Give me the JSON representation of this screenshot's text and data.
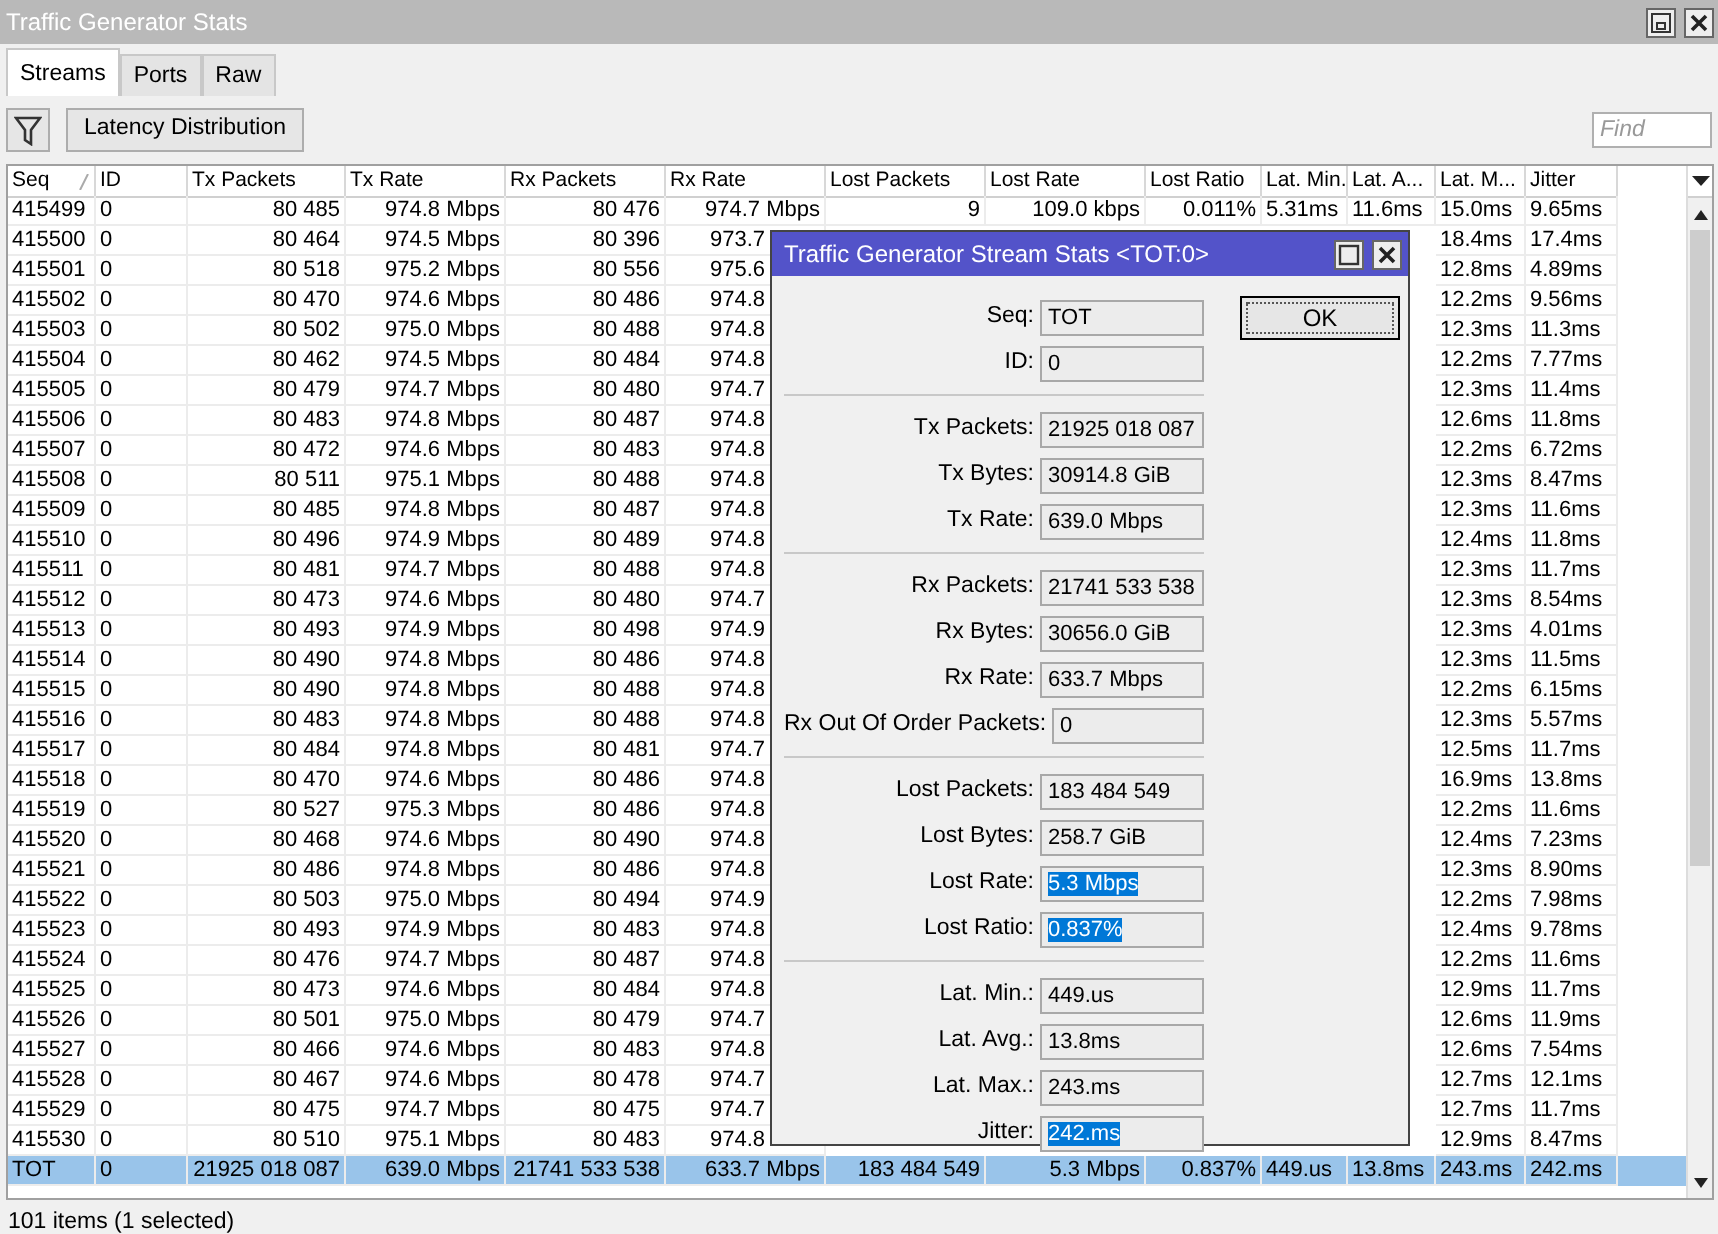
{
  "window": {
    "title": "Traffic Generator Stats"
  },
  "tabs": [
    {
      "label": "Streams",
      "selected": true
    },
    {
      "label": "Ports",
      "selected": false
    },
    {
      "label": "Raw",
      "selected": false
    }
  ],
  "toolbar": {
    "buttons": [
      "Latency Distribution"
    ],
    "find": {
      "placeholder": "Find"
    }
  },
  "table": {
    "columns": [
      {
        "label": "Seq",
        "sorted": true
      },
      {
        "label": "ID",
        "sorted": false
      },
      {
        "label": "Tx Packets",
        "sorted": false
      },
      {
        "label": "Tx Rate",
        "sorted": false
      },
      {
        "label": "Rx Packets",
        "sorted": false
      },
      {
        "label": "Rx Rate",
        "sorted": false
      },
      {
        "label": "Lost Packets",
        "sorted": false
      },
      {
        "label": "Lost Rate",
        "sorted": false
      },
      {
        "label": "Lost Ratio",
        "sorted": false
      },
      {
        "label": "Lat. Min.",
        "sorted": false
      },
      {
        "label": "Lat. A...",
        "sorted": false
      },
      {
        "label": "Lat. M...",
        "sorted": false
      },
      {
        "label": "Jitter",
        "sorted": false
      }
    ],
    "rows": [
      {
        "selected": false,
        "cells": [
          "415499",
          "0",
          "80 485",
          "974.8 Mbps",
          "80 476",
          "974.7 Mbps",
          "9",
          "109.0 kbps",
          "0.011%",
          "5.31ms",
          "11.6ms",
          "15.0ms",
          "9.65ms"
        ]
      },
      {
        "selected": false,
        "cells": [
          "415500",
          "0",
          "80 464",
          "974.5 Mbps",
          "80 396",
          "973.7",
          null,
          null,
          null,
          null,
          null,
          "18.4ms",
          "17.4ms"
        ]
      },
      {
        "selected": false,
        "cells": [
          "415501",
          "0",
          "80 518",
          "975.2 Mbps",
          "80 556",
          "975.6",
          null,
          null,
          null,
          null,
          null,
          "12.8ms",
          "4.89ms"
        ]
      },
      {
        "selected": false,
        "cells": [
          "415502",
          "0",
          "80 470",
          "974.6 Mbps",
          "80 486",
          "974.8",
          null,
          null,
          null,
          null,
          null,
          "12.2ms",
          "9.56ms"
        ]
      },
      {
        "selected": false,
        "cells": [
          "415503",
          "0",
          "80 502",
          "975.0 Mbps",
          "80 488",
          "974.8",
          null,
          null,
          null,
          null,
          null,
          "12.3ms",
          "11.3ms"
        ]
      },
      {
        "selected": false,
        "cells": [
          "415504",
          "0",
          "80 462",
          "974.5 Mbps",
          "80 484",
          "974.8",
          null,
          null,
          null,
          null,
          null,
          "12.2ms",
          "7.77ms"
        ]
      },
      {
        "selected": false,
        "cells": [
          "415505",
          "0",
          "80 479",
          "974.7 Mbps",
          "80 480",
          "974.7",
          null,
          null,
          null,
          null,
          null,
          "12.3ms",
          "11.4ms"
        ]
      },
      {
        "selected": false,
        "cells": [
          "415506",
          "0",
          "80 483",
          "974.8 Mbps",
          "80 487",
          "974.8",
          null,
          null,
          null,
          null,
          null,
          "12.6ms",
          "11.8ms"
        ]
      },
      {
        "selected": false,
        "cells": [
          "415507",
          "0",
          "80 472",
          "974.6 Mbps",
          "80 483",
          "974.8",
          null,
          null,
          null,
          null,
          null,
          "12.2ms",
          "6.72ms"
        ]
      },
      {
        "selected": false,
        "cells": [
          "415508",
          "0",
          "80 511",
          "975.1 Mbps",
          "80 488",
          "974.8",
          null,
          null,
          null,
          null,
          null,
          "12.3ms",
          "8.47ms"
        ]
      },
      {
        "selected": false,
        "cells": [
          "415509",
          "0",
          "80 485",
          "974.8 Mbps",
          "80 487",
          "974.8",
          null,
          null,
          null,
          null,
          null,
          "12.3ms",
          "11.6ms"
        ]
      },
      {
        "selected": false,
        "cells": [
          "415510",
          "0",
          "80 496",
          "974.9 Mbps",
          "80 489",
          "974.8",
          null,
          null,
          null,
          null,
          null,
          "12.4ms",
          "11.8ms"
        ]
      },
      {
        "selected": false,
        "cells": [
          "415511",
          "0",
          "80 481",
          "974.7 Mbps",
          "80 488",
          "974.8",
          null,
          null,
          null,
          null,
          null,
          "12.3ms",
          "11.7ms"
        ]
      },
      {
        "selected": false,
        "cells": [
          "415512",
          "0",
          "80 473",
          "974.6 Mbps",
          "80 480",
          "974.7",
          null,
          null,
          null,
          null,
          null,
          "12.3ms",
          "8.54ms"
        ]
      },
      {
        "selected": false,
        "cells": [
          "415513",
          "0",
          "80 493",
          "974.9 Mbps",
          "80 498",
          "974.9",
          null,
          null,
          null,
          null,
          null,
          "12.3ms",
          "4.01ms"
        ]
      },
      {
        "selected": false,
        "cells": [
          "415514",
          "0",
          "80 490",
          "974.8 Mbps",
          "80 486",
          "974.8",
          null,
          null,
          null,
          null,
          null,
          "12.3ms",
          "11.5ms"
        ]
      },
      {
        "selected": false,
        "cells": [
          "415515",
          "0",
          "80 490",
          "974.8 Mbps",
          "80 488",
          "974.8",
          null,
          null,
          null,
          null,
          null,
          "12.2ms",
          "6.15ms"
        ]
      },
      {
        "selected": false,
        "cells": [
          "415516",
          "0",
          "80 483",
          "974.8 Mbps",
          "80 488",
          "974.8",
          null,
          null,
          null,
          null,
          null,
          "12.3ms",
          "5.57ms"
        ]
      },
      {
        "selected": false,
        "cells": [
          "415517",
          "0",
          "80 484",
          "974.8 Mbps",
          "80 481",
          "974.7",
          null,
          null,
          null,
          null,
          null,
          "12.5ms",
          "11.7ms"
        ]
      },
      {
        "selected": false,
        "cells": [
          "415518",
          "0",
          "80 470",
          "974.6 Mbps",
          "80 486",
          "974.8",
          null,
          null,
          null,
          null,
          null,
          "16.9ms",
          "13.8ms"
        ]
      },
      {
        "selected": false,
        "cells": [
          "415519",
          "0",
          "80 527",
          "975.3 Mbps",
          "80 486",
          "974.8",
          null,
          null,
          null,
          null,
          null,
          "12.2ms",
          "11.6ms"
        ]
      },
      {
        "selected": false,
        "cells": [
          "415520",
          "0",
          "80 468",
          "974.6 Mbps",
          "80 490",
          "974.8",
          null,
          null,
          null,
          null,
          null,
          "12.4ms",
          "7.23ms"
        ]
      },
      {
        "selected": false,
        "cells": [
          "415521",
          "0",
          "80 486",
          "974.8 Mbps",
          "80 486",
          "974.8",
          null,
          null,
          null,
          null,
          null,
          "12.3ms",
          "8.90ms"
        ]
      },
      {
        "selected": false,
        "cells": [
          "415522",
          "0",
          "80 503",
          "975.0 Mbps",
          "80 494",
          "974.9",
          null,
          null,
          null,
          null,
          null,
          "12.2ms",
          "7.98ms"
        ]
      },
      {
        "selected": false,
        "cells": [
          "415523",
          "0",
          "80 493",
          "974.9 Mbps",
          "80 483",
          "974.8",
          null,
          null,
          null,
          null,
          null,
          "12.4ms",
          "9.78ms"
        ]
      },
      {
        "selected": false,
        "cells": [
          "415524",
          "0",
          "80 476",
          "974.7 Mbps",
          "80 487",
          "974.8",
          null,
          null,
          null,
          null,
          null,
          "12.2ms",
          "11.6ms"
        ]
      },
      {
        "selected": false,
        "cells": [
          "415525",
          "0",
          "80 473",
          "974.6 Mbps",
          "80 484",
          "974.8",
          null,
          null,
          null,
          null,
          null,
          "12.9ms",
          "11.7ms"
        ]
      },
      {
        "selected": false,
        "cells": [
          "415526",
          "0",
          "80 501",
          "975.0 Mbps",
          "80 479",
          "974.7",
          null,
          null,
          null,
          null,
          null,
          "12.6ms",
          "11.9ms"
        ]
      },
      {
        "selected": false,
        "cells": [
          "415527",
          "0",
          "80 466",
          "974.6 Mbps",
          "80 483",
          "974.8",
          null,
          null,
          null,
          null,
          null,
          "12.6ms",
          "7.54ms"
        ]
      },
      {
        "selected": false,
        "cells": [
          "415528",
          "0",
          "80 467",
          "974.6 Mbps",
          "80 478",
          "974.7",
          null,
          null,
          null,
          null,
          null,
          "12.7ms",
          "12.1ms"
        ]
      },
      {
        "selected": false,
        "cells": [
          "415529",
          "0",
          "80 475",
          "974.7 Mbps",
          "80 475",
          "974.7",
          null,
          null,
          null,
          null,
          null,
          "12.7ms",
          "11.7ms"
        ]
      },
      {
        "selected": false,
        "cells": [
          "415530",
          "0",
          "80 510",
          "975.1 Mbps",
          "80 483",
          "974.8",
          null,
          null,
          null,
          null,
          null,
          "12.9ms",
          "8.47ms"
        ]
      },
      {
        "selected": true,
        "cells": [
          "TOT",
          "0",
          "21925 018 087",
          "639.0 Mbps",
          "21741 533 538",
          "633.7 Mbps",
          "183 484 549",
          "5.3 Mbps",
          "0.837%",
          "449.us",
          "13.8ms",
          "243.ms",
          "242.ms"
        ]
      }
    ]
  },
  "status_bar": "101 items (1 selected)",
  "dialog": {
    "title": "Traffic Generator Stream Stats <TOT:0>",
    "ok_button": "OK",
    "groups": [
      [
        {
          "label": "Seq:",
          "value": "TOT",
          "selected": false
        },
        {
          "label": "ID:",
          "value": "0",
          "selected": false
        }
      ],
      [
        {
          "label": "Tx Packets:",
          "value": "21925 018 087",
          "selected": false
        },
        {
          "label": "Tx Bytes:",
          "value": "30914.8 GiB",
          "selected": false
        },
        {
          "label": "Tx Rate:",
          "value": "639.0 Mbps",
          "selected": false
        }
      ],
      [
        {
          "label": "Rx Packets:",
          "value": "21741 533 538",
          "selected": false
        },
        {
          "label": "Rx Bytes:",
          "value": "30656.0 GiB",
          "selected": false
        },
        {
          "label": "Rx Rate:",
          "value": "633.7 Mbps",
          "selected": false
        },
        {
          "label": "Rx Out Of Order Packets:",
          "value": "0",
          "selected": false
        }
      ],
      [
        {
          "label": "Lost Packets:",
          "value": "183 484 549",
          "selected": false
        },
        {
          "label": "Lost Bytes:",
          "value": "258.7 GiB",
          "selected": false
        },
        {
          "label": "Lost Rate:",
          "value": "5.3 Mbps",
          "selected": true
        },
        {
          "label": "Lost Ratio:",
          "value": "0.837%",
          "selected": true
        }
      ],
      [
        {
          "label": "Lat. Min.:",
          "value": "449.us",
          "selected": false
        },
        {
          "label": "Lat. Avg.:",
          "value": "13.8ms",
          "selected": false
        },
        {
          "label": "Lat. Max.:",
          "value": "243.ms",
          "selected": false
        },
        {
          "label": "Jitter:",
          "value": "242.ms",
          "selected": true
        }
      ]
    ]
  }
}
